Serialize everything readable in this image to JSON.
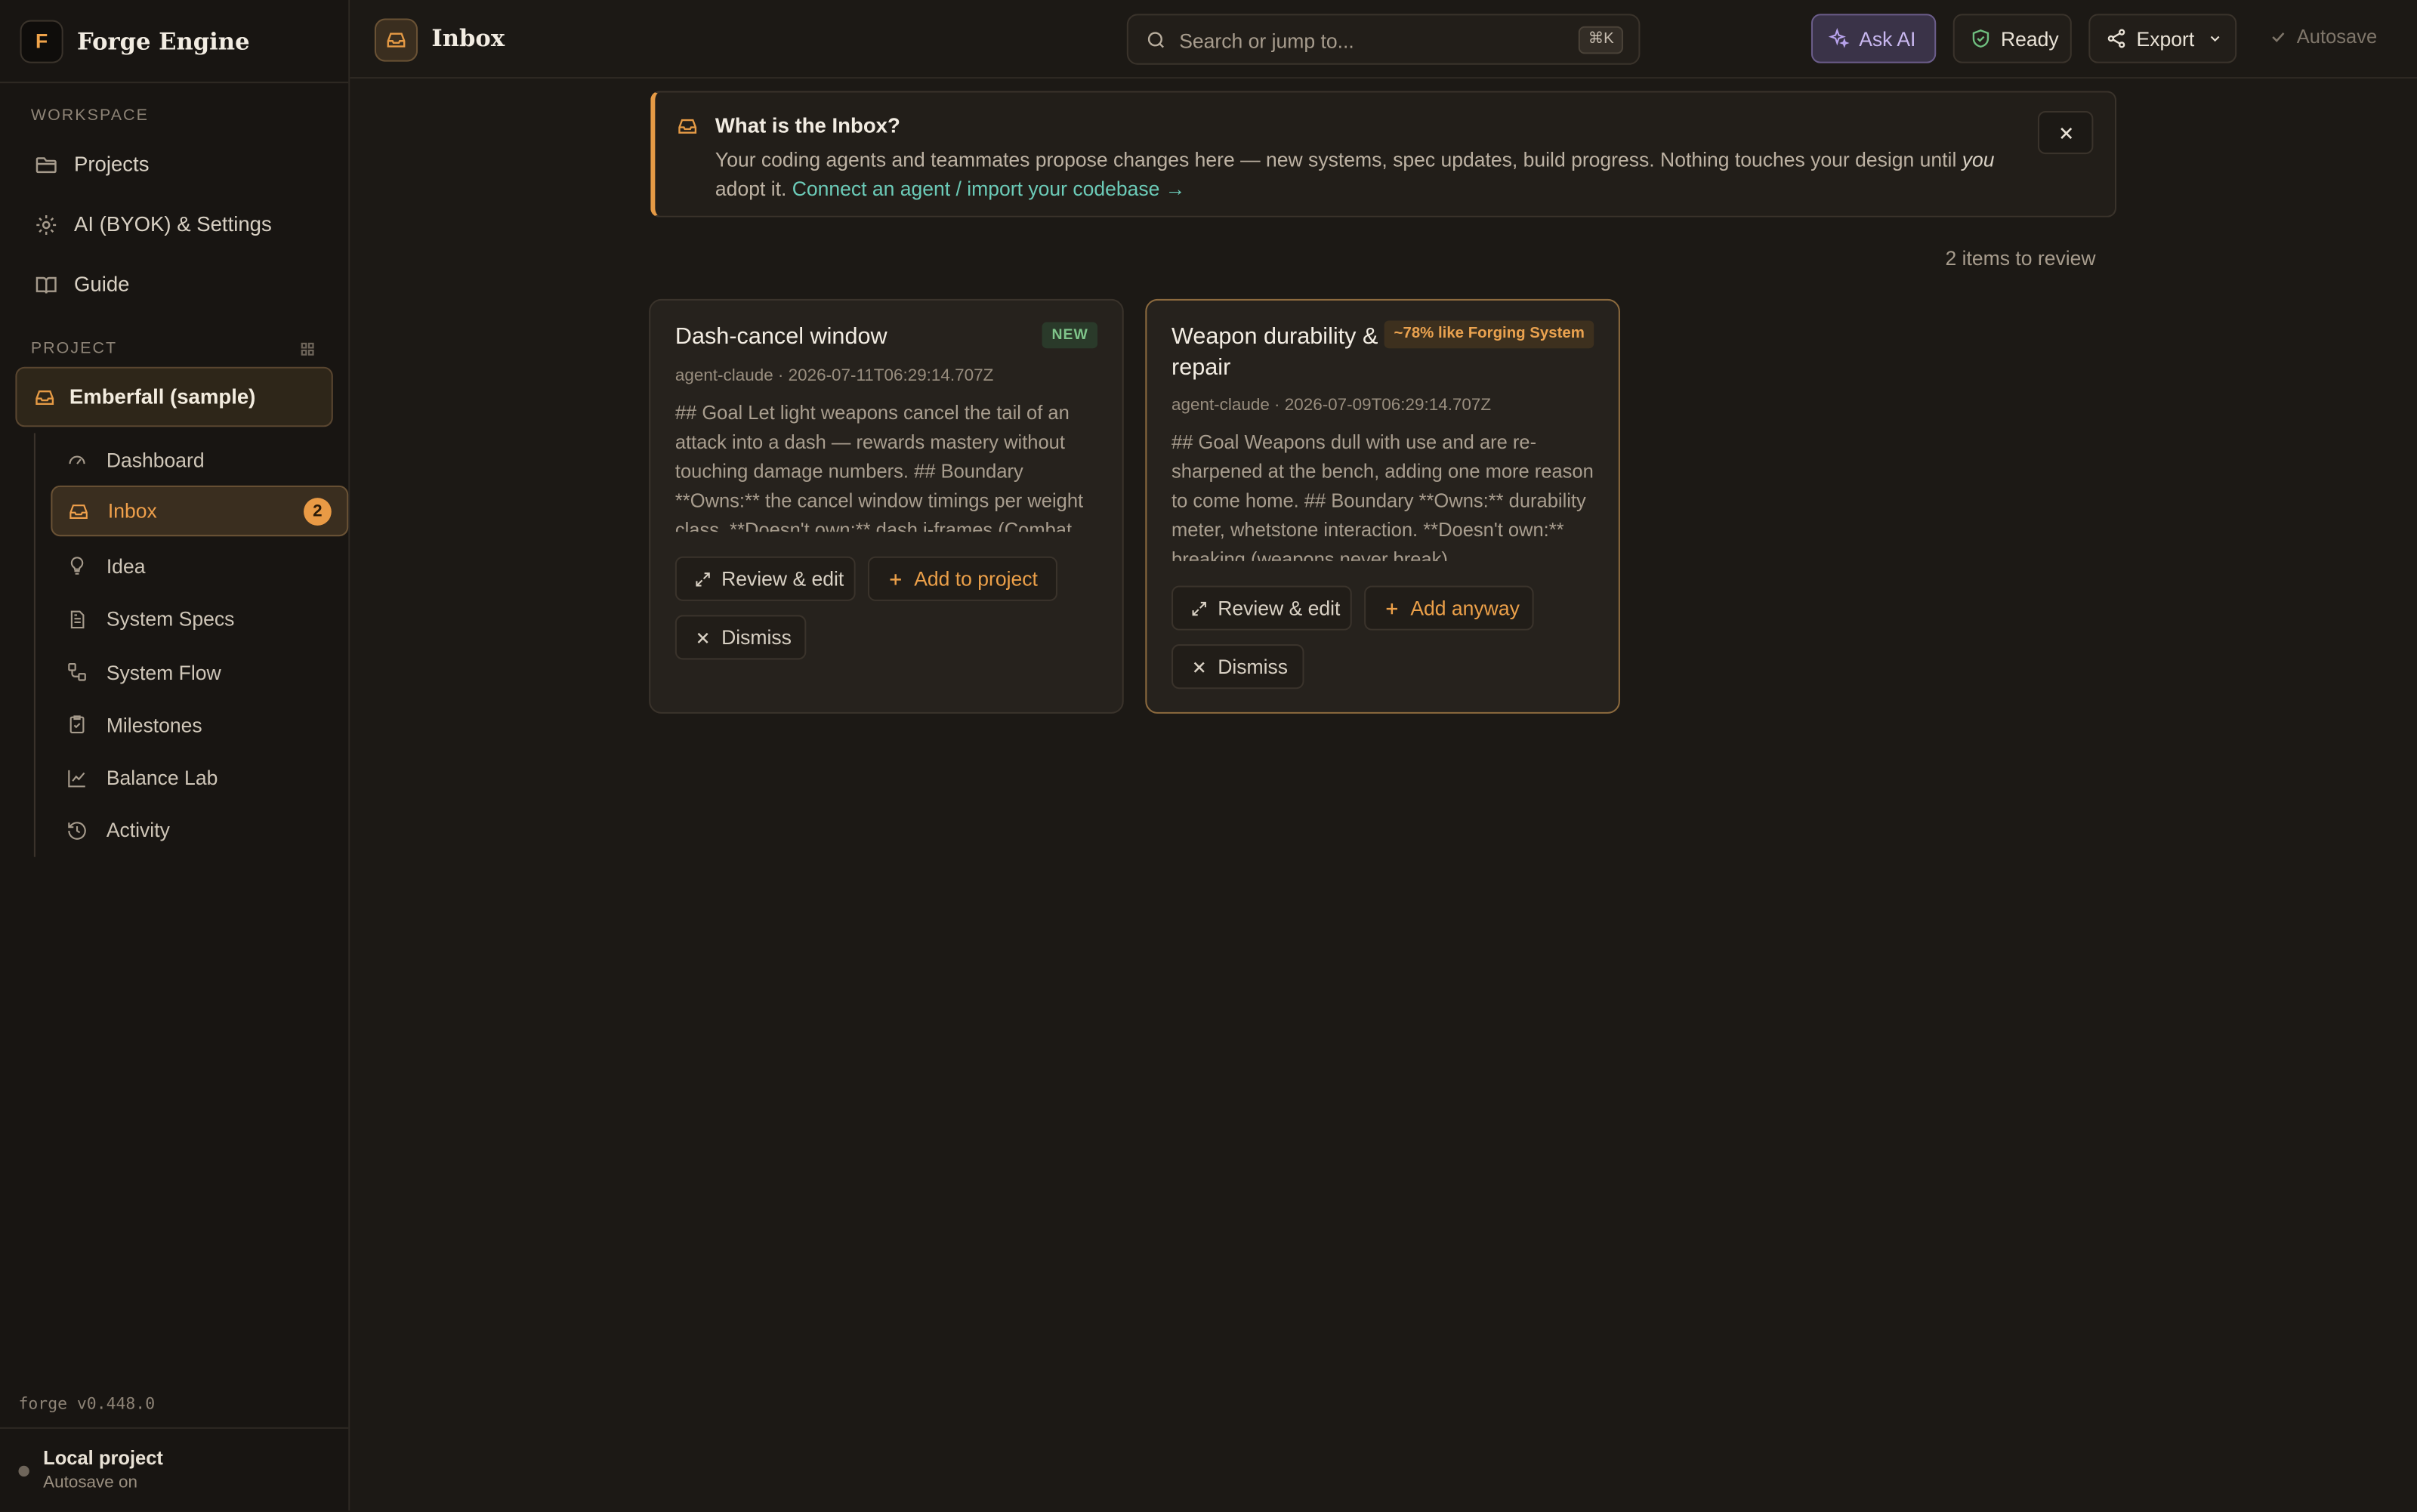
{
  "app": {
    "name": "Forge Engine",
    "logo_text": "F",
    "version": "forge v0.448.0"
  },
  "sidebar": {
    "workspace_label": "WORKSPACE",
    "workspace_items": [
      {
        "label": "Projects",
        "icon": "folder-icon"
      },
      {
        "label": "AI (BYOK) & Settings",
        "icon": "gear-icon"
      },
      {
        "label": "Guide",
        "icon": "book-icon"
      }
    ],
    "project_label": "PROJECT",
    "project_name": "Emberfall (sample)",
    "project_items": [
      {
        "label": "Dashboard",
        "icon": "gauge-icon"
      },
      {
        "label": "Inbox",
        "icon": "inbox-icon",
        "badge": "2",
        "active": true
      },
      {
        "label": "Idea",
        "icon": "lightbulb-icon"
      },
      {
        "label": "System Specs",
        "icon": "document-icon"
      },
      {
        "label": "System Flow",
        "icon": "flow-icon"
      },
      {
        "label": "Milestones",
        "icon": "clipboard-check-icon"
      },
      {
        "label": "Balance Lab",
        "icon": "chart-line-icon"
      },
      {
        "label": "Activity",
        "icon": "history-icon"
      }
    ],
    "footer": {
      "title": "Local project",
      "subtitle": "Autosave on"
    }
  },
  "topbar": {
    "title": "Inbox",
    "search_placeholder": "Search or jump to...",
    "search_shortcut": "⌘K",
    "ask_ai_label": "Ask AI",
    "ready_label": "Ready",
    "export_label": "Export",
    "autosave_label": "Autosave"
  },
  "banner": {
    "title": "What is the Inbox?",
    "body_before": "Your coding agents and teammates propose changes here — new systems, spec updates, build progress. Nothing touches your design until ",
    "body_emphasis": "you",
    "body_after": " adopt it. ",
    "link": "Connect an agent / import your codebase →"
  },
  "review_count": "2 items to review",
  "cards": [
    {
      "title": "Dash-cancel window",
      "tag": "NEW",
      "meta": "agent-claude · 2026-07-11T06:29:14.707Z",
      "body": "## Goal Let light weapons cancel the tail of an attack into a dash — rewards mastery without touching damage numbers. ## Boundary **Owns:** the cancel window timings per weight class. **Doesn't own:** dash i-frames (Combat System).",
      "review_label": "Review & edit",
      "add_label": "Add to project",
      "dismiss_label": "Dismiss"
    },
    {
      "title": "Weapon durability & repair",
      "tag": "~78% like Forging System",
      "meta": "agent-claude · 2026-07-09T06:29:14.707Z",
      "body": "## Goal Weapons dull with use and are re-sharpened at the bench, adding one more reason to come home. ## Boundary **Owns:** durability meter, whetstone interaction. **Doesn't own:** breaking (weapons never break).",
      "review_label": "Review & edit",
      "add_label": "Add anyway",
      "dismiss_label": "Dismiss"
    }
  ],
  "colors": {
    "background": "#1c1915",
    "sidebar": "#181512",
    "accent": "#e59a45",
    "link": "#6ccbb8",
    "ai": "#b9a4ee",
    "ready": "#6fbf7f"
  }
}
